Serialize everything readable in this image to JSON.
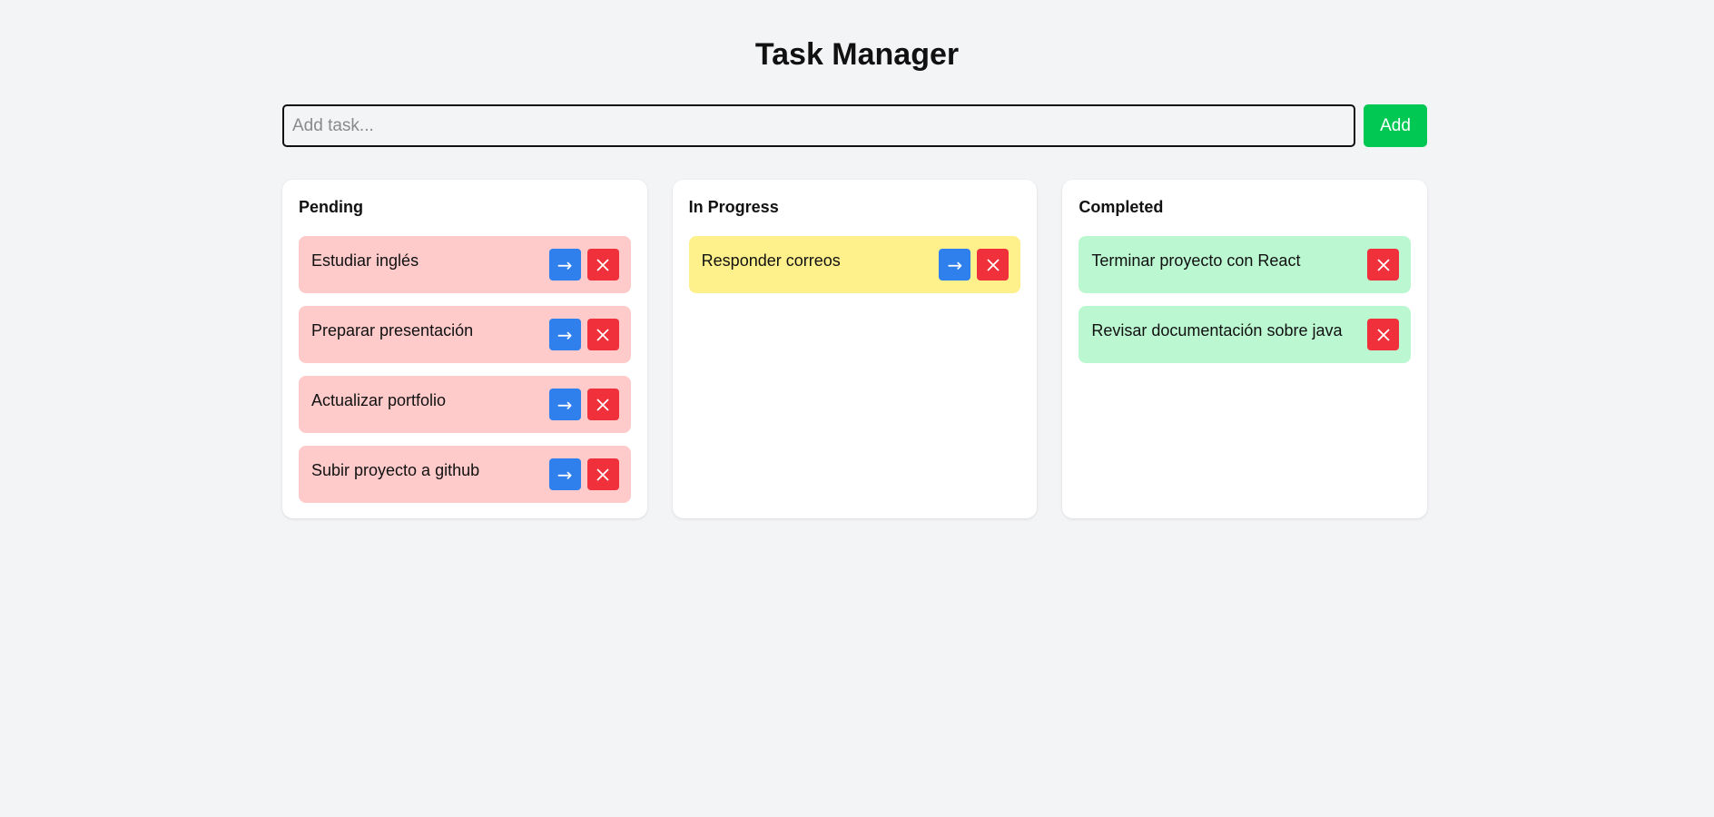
{
  "app": {
    "title": "Task Manager"
  },
  "input": {
    "placeholder": "Add task...",
    "value": "",
    "add_label": "Add"
  },
  "icons": {
    "move": "arrow-right-icon",
    "delete": "close-icon"
  },
  "colors": {
    "add_button": "#00c853",
    "move_button": "#2f80ed",
    "delete_button": "#f0303a",
    "pending_card": "#fecaca",
    "progress_card": "#fef08a",
    "completed_card": "#bbf7d0"
  },
  "columns": [
    {
      "title": "Pending",
      "tasks": [
        {
          "text": "Estudiar inglés"
        },
        {
          "text": "Preparar presentación"
        },
        {
          "text": "Actualizar portfolio"
        },
        {
          "text": "Subir proyecto a github"
        }
      ]
    },
    {
      "title": "In Progress",
      "tasks": [
        {
          "text": "Responder correos"
        }
      ]
    },
    {
      "title": "Completed",
      "tasks": [
        {
          "text": "Terminar proyecto con React"
        },
        {
          "text": "Revisar documentación sobre java"
        }
      ]
    }
  ]
}
